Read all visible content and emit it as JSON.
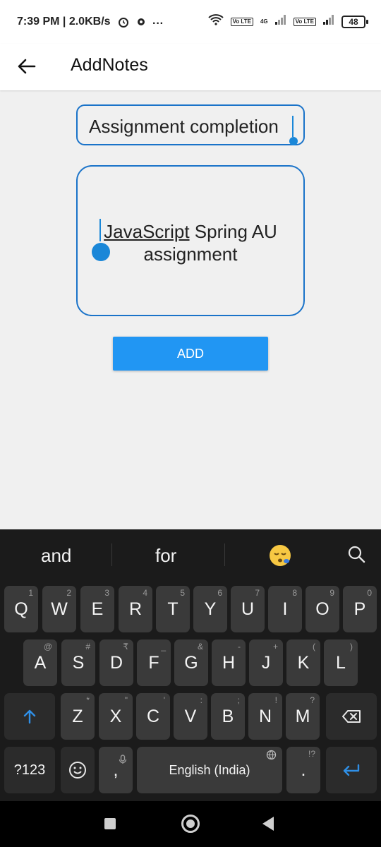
{
  "status_bar": {
    "time": "7:39 PM | 2.0KB/s",
    "overflow": "···",
    "net_tag1": "Vo LTE",
    "net_tag2": "Vo LTE",
    "network": "4G",
    "battery": "48"
  },
  "app_bar": {
    "title": "AddNotes"
  },
  "note": {
    "title_value": "Assignment completion",
    "body_underlined": "JavaScript",
    "body_rest": " Spring AU assignment"
  },
  "add_button": {
    "label": "ADD"
  },
  "keyboard": {
    "suggestions": [
      "and",
      "for"
    ],
    "row1": [
      {
        "k": "Q",
        "h": "1"
      },
      {
        "k": "W",
        "h": "2"
      },
      {
        "k": "E",
        "h": "3"
      },
      {
        "k": "R",
        "h": "4"
      },
      {
        "k": "T",
        "h": "5"
      },
      {
        "k": "Y",
        "h": "6"
      },
      {
        "k": "U",
        "h": "7"
      },
      {
        "k": "I",
        "h": "8"
      },
      {
        "k": "O",
        "h": "9"
      },
      {
        "k": "P",
        "h": "0"
      }
    ],
    "row2": [
      {
        "k": "A",
        "h": "@"
      },
      {
        "k": "S",
        "h": "#"
      },
      {
        "k": "D",
        "h": "₹"
      },
      {
        "k": "F",
        "h": "_"
      },
      {
        "k": "G",
        "h": "&"
      },
      {
        "k": "H",
        "h": "-"
      },
      {
        "k": "J",
        "h": "+"
      },
      {
        "k": "K",
        "h": "("
      },
      {
        "k": "L",
        "h": ")"
      }
    ],
    "row3": [
      {
        "k": "Z",
        "h": "*"
      },
      {
        "k": "X",
        "h": "\""
      },
      {
        "k": "C",
        "h": "'"
      },
      {
        "k": "V",
        "h": ":"
      },
      {
        "k": "B",
        "h": ";"
      },
      {
        "k": "N",
        "h": "!"
      },
      {
        "k": "M",
        "h": "?"
      }
    ],
    "symbols_key": "?123",
    "comma_key": ",",
    "space_label": "English (India)",
    "period_key": ".",
    "period_hint": "!?"
  },
  "colors": {
    "accent": "#2196f3",
    "field_border": "#1a73c9",
    "cursor": "#1a87d8",
    "keyboard_bg": "#1b1b1b",
    "key_bg": "#3a3a3a"
  }
}
